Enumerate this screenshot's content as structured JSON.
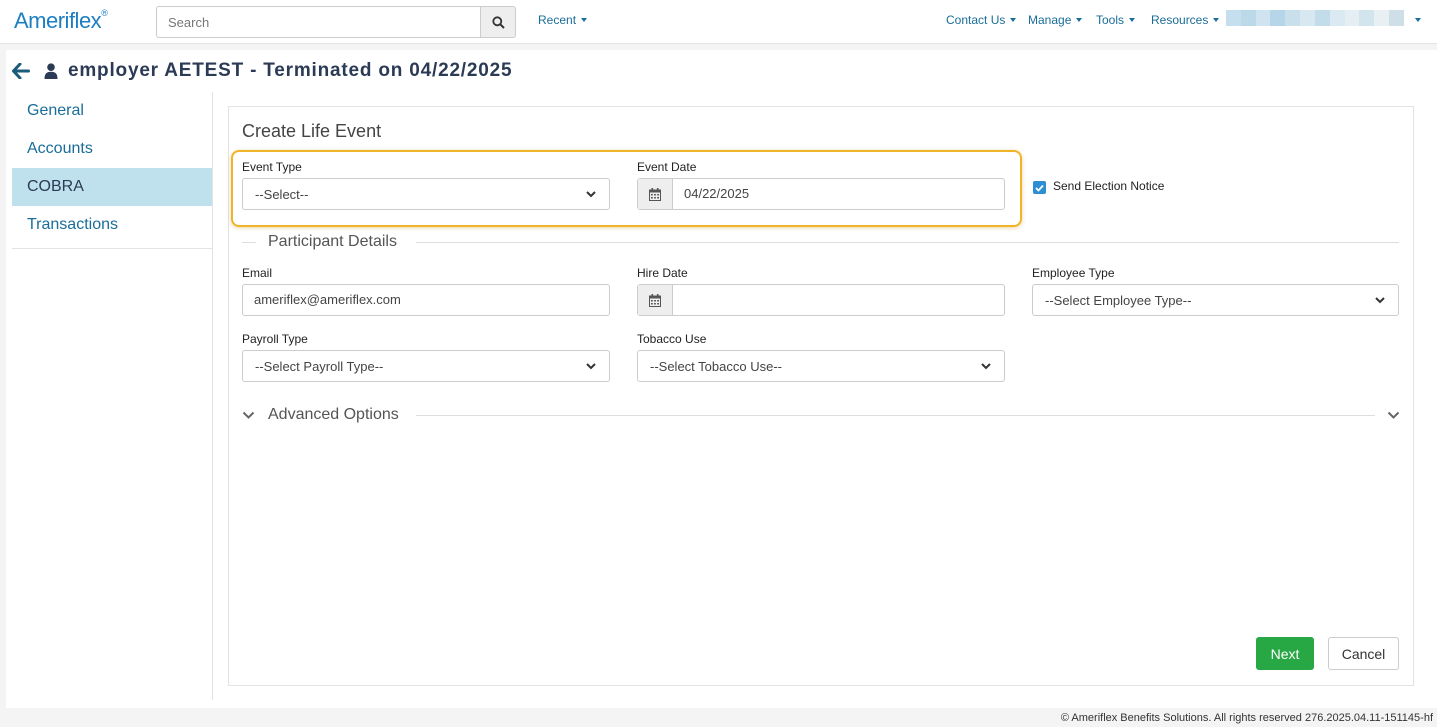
{
  "brand": {
    "logo_text": "Ameriflex",
    "logo_mark": "®"
  },
  "search": {
    "placeholder": "Search"
  },
  "nav": {
    "recent": "Recent",
    "contact_us": "Contact Us",
    "manage": "Manage",
    "tools": "Tools",
    "resources": "Resources"
  },
  "page": {
    "title": "employer AETEST - Terminated on 04/22/2025"
  },
  "sidebar": {
    "items": [
      {
        "label": "General"
      },
      {
        "label": "Accounts"
      },
      {
        "label": "COBRA"
      },
      {
        "label": "Transactions"
      }
    ]
  },
  "form": {
    "title": "Create Life Event",
    "event_type": {
      "label": "Event Type",
      "value": "--Select--"
    },
    "event_date": {
      "label": "Event Date",
      "value": "04/22/2025"
    },
    "send_notice": {
      "label": "Send Election Notice",
      "checked": true
    },
    "participant_section": "Participant Details",
    "email": {
      "label": "Email",
      "value": "ameriflex@ameriflex.com"
    },
    "hire_date": {
      "label": "Hire Date",
      "value": ""
    },
    "employee_type": {
      "label": "Employee Type",
      "value": "--Select Employee Type--"
    },
    "payroll_type": {
      "label": "Payroll Type",
      "value": "--Select Payroll Type--"
    },
    "tobacco_use": {
      "label": "Tobacco Use",
      "value": "--Select Tobacco Use--"
    },
    "advanced_section": "Advanced Options",
    "next_label": "Next",
    "cancel_label": "Cancel"
  },
  "footer": {
    "text": "© Ameriflex Benefits Solutions. All rights reserved 276.2025.04.11-151145-hf"
  },
  "colors": {
    "accent": "#1a6d9a",
    "active_bg": "#bfe1ed",
    "highlight": "#f0b429",
    "next_btn": "#28a745"
  }
}
